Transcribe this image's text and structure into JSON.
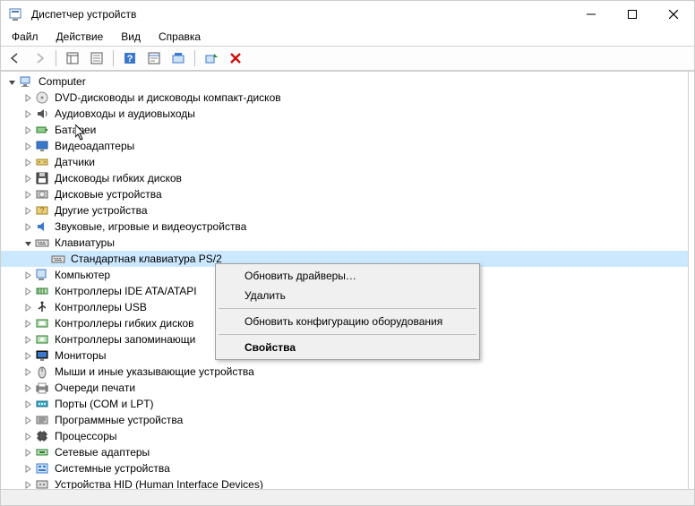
{
  "window": {
    "title": "Диспетчер устройств"
  },
  "menu": {
    "file": "Файл",
    "action": "Действие",
    "view": "Вид",
    "help": "Справка"
  },
  "tree": {
    "root": "Computer",
    "items": [
      {
        "label": "DVD-дисководы и дисководы компакт-дисков",
        "icon": "disc"
      },
      {
        "label": "Аудиовходы и аудиовыходы",
        "icon": "audio"
      },
      {
        "label": "Батареи",
        "icon": "battery"
      },
      {
        "label": "Видеоадаптеры",
        "icon": "display"
      },
      {
        "label": "Датчики",
        "icon": "sensor"
      },
      {
        "label": "Дисководы гибких дисков",
        "icon": "floppy"
      },
      {
        "label": "Дисковые устройства",
        "icon": "hdd"
      },
      {
        "label": "Другие устройства",
        "icon": "other"
      },
      {
        "label": "Звуковые, игровые и видеоустройства",
        "icon": "sound"
      },
      {
        "label": "Клавиатуры",
        "icon": "keyboard",
        "expanded": true,
        "children": [
          {
            "label": "Стандартная клавиатура PS/2",
            "icon": "keyboard",
            "selected": true
          }
        ]
      },
      {
        "label": "Компьютер",
        "icon": "computer"
      },
      {
        "label": "Контроллеры IDE ATA/ATAPI",
        "icon": "ide"
      },
      {
        "label": "Контроллеры USB",
        "icon": "usb"
      },
      {
        "label": "Контроллеры гибких дисков",
        "icon": "floppyctl"
      },
      {
        "label": "Контроллеры запоминающи",
        "icon": "storage"
      },
      {
        "label": "Мониторы",
        "icon": "monitor"
      },
      {
        "label": "Мыши и иные указывающие устройства",
        "icon": "mouse"
      },
      {
        "label": "Очереди печати",
        "icon": "print"
      },
      {
        "label": "Порты (COM и LPT)",
        "icon": "port"
      },
      {
        "label": "Программные устройства",
        "icon": "soft"
      },
      {
        "label": "Процессоры",
        "icon": "cpu"
      },
      {
        "label": "Сетевые адаптеры",
        "icon": "net"
      },
      {
        "label": "Системные устройства",
        "icon": "sys"
      },
      {
        "label": "Устройства HID (Human Interface Devices)",
        "icon": "hid"
      }
    ]
  },
  "context_menu": {
    "update": "Обновить драйверы…",
    "delete": "Удалить",
    "rescan": "Обновить конфигурацию оборудования",
    "props": "Свойства"
  }
}
